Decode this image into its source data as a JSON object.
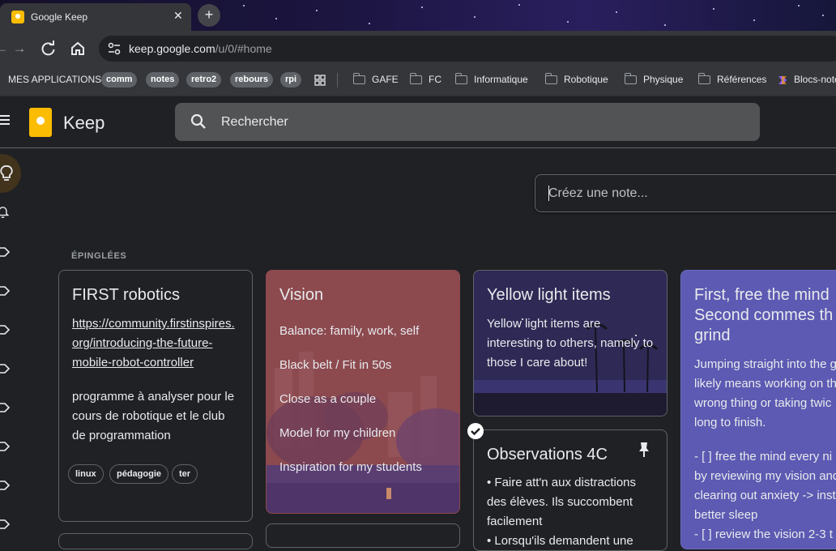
{
  "browser": {
    "tab_title": "Google Keep",
    "tab_close": "✕",
    "new_tab": "+",
    "url_host": "keep.google.com",
    "url_path": "/u/0/#home"
  },
  "bookmarks": {
    "apps_label": "MES APPLICATIONS",
    "chips": [
      "comm",
      "notes",
      "retro2",
      "rebours",
      "rpi"
    ],
    "folders": [
      "GAFE",
      "FC",
      "Informatique",
      "Robotique",
      "Physique",
      "Références"
    ],
    "last": "Blocs-note"
  },
  "keep": {
    "title": "Keep",
    "search_placeholder": "Rechercher",
    "take_note_placeholder": "Créez une note...",
    "pinned_label": "ÉPINGLÉES"
  },
  "notes": {
    "first": {
      "title": "FIRST robotics",
      "link_lines": [
        "https://community.firstinspires.",
        "org/introducing-the-future-",
        "mobile-robot-controller"
      ],
      "body_lines": [
        "programme à analyser pour le",
        "cours de robotique et le club",
        "de programmation"
      ],
      "labels": [
        "linux",
        "pédagogie",
        "ter"
      ]
    },
    "vision": {
      "title": "Vision",
      "items": [
        "Balance: family, work, self",
        "Black belt / Fit in 50s",
        "Close as a couple",
        "Model for my children",
        "Inspiration for my students"
      ],
      "bg_color": "#8c4a4f"
    },
    "yellow": {
      "title": "Yellow light items",
      "body_lines": [
        "Yellow light items are",
        "interesting to others, namely to",
        "those I care about!"
      ]
    },
    "observations": {
      "title": "Observations 4C",
      "body_lines": [
        "• Faire att'n aux distractions",
        "des élèves. Ils succombent",
        "facilement",
        "• Lorsqu'ils demandent une"
      ]
    },
    "mind": {
      "title_lines": [
        "First, free the mind",
        "Second commes th",
        "grind"
      ],
      "body_lines": [
        "Jumping straight into the g",
        "likely means working on th",
        "wrong thing or taking twic",
        "long to finish.",
        "",
        "- [ ] free the mind every ni",
        "by reviewing my vision and",
        "clearing out anxiety -> inst",
        "better sleep",
        "- [ ] review the vision 2-3 t"
      ],
      "bg_color": "#5c5ab2"
    }
  },
  "icons": [
    "menu-icon",
    "keep-logo-icon",
    "search-icon",
    "lightbulb-icon",
    "bell-icon",
    "label-icon",
    "pin-icon",
    "check-icon",
    "back-icon",
    "forward-icon",
    "reload-icon",
    "home-icon",
    "site-info-icon",
    "apps-grid-icon",
    "folder-icon"
  ]
}
